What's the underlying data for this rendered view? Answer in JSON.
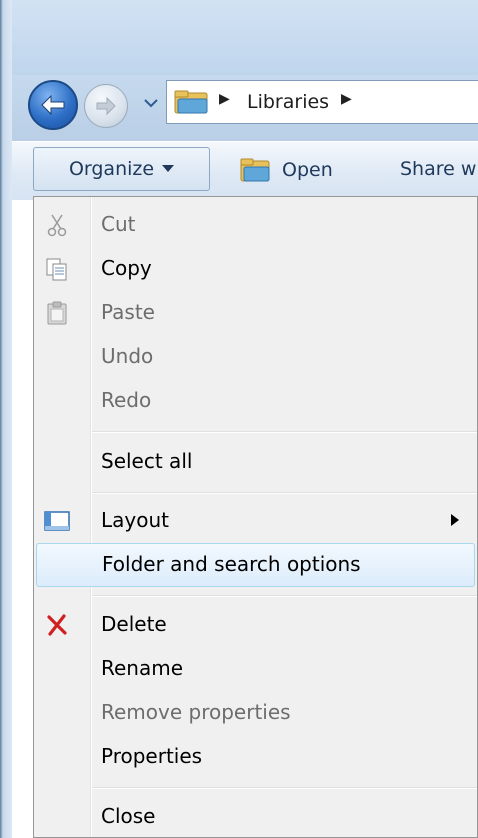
{
  "nav": {
    "address": {
      "label": "Libraries"
    }
  },
  "toolbar": {
    "organize_label": "Organize",
    "open_label": "Open",
    "share_label": "Share w"
  },
  "menu": {
    "items": [
      {
        "label": "Cut",
        "enabled": false,
        "icon": "scissors-icon"
      },
      {
        "label": "Copy",
        "enabled": true,
        "icon": "copy-icon"
      },
      {
        "label": "Paste",
        "enabled": false,
        "icon": "paste-icon"
      },
      {
        "label": "Undo",
        "enabled": false
      },
      {
        "label": "Redo",
        "enabled": false
      },
      {
        "label": "Select all",
        "enabled": true
      },
      {
        "label": "Layout",
        "enabled": true,
        "icon": "layout-icon",
        "submenu": true
      },
      {
        "label": "Folder and search options",
        "enabled": true,
        "highlighted": true
      },
      {
        "label": "Delete",
        "enabled": true,
        "icon": "delete-icon"
      },
      {
        "label": "Rename",
        "enabled": true
      },
      {
        "label": "Remove properties",
        "enabled": false
      },
      {
        "label": "Properties",
        "enabled": true
      },
      {
        "label": "Close",
        "enabled": true
      }
    ]
  },
  "colors": {
    "highlight_border": "#a8d8eb",
    "disabled_text": "#6d6d6d",
    "menu_background": "#f0f0f0"
  }
}
